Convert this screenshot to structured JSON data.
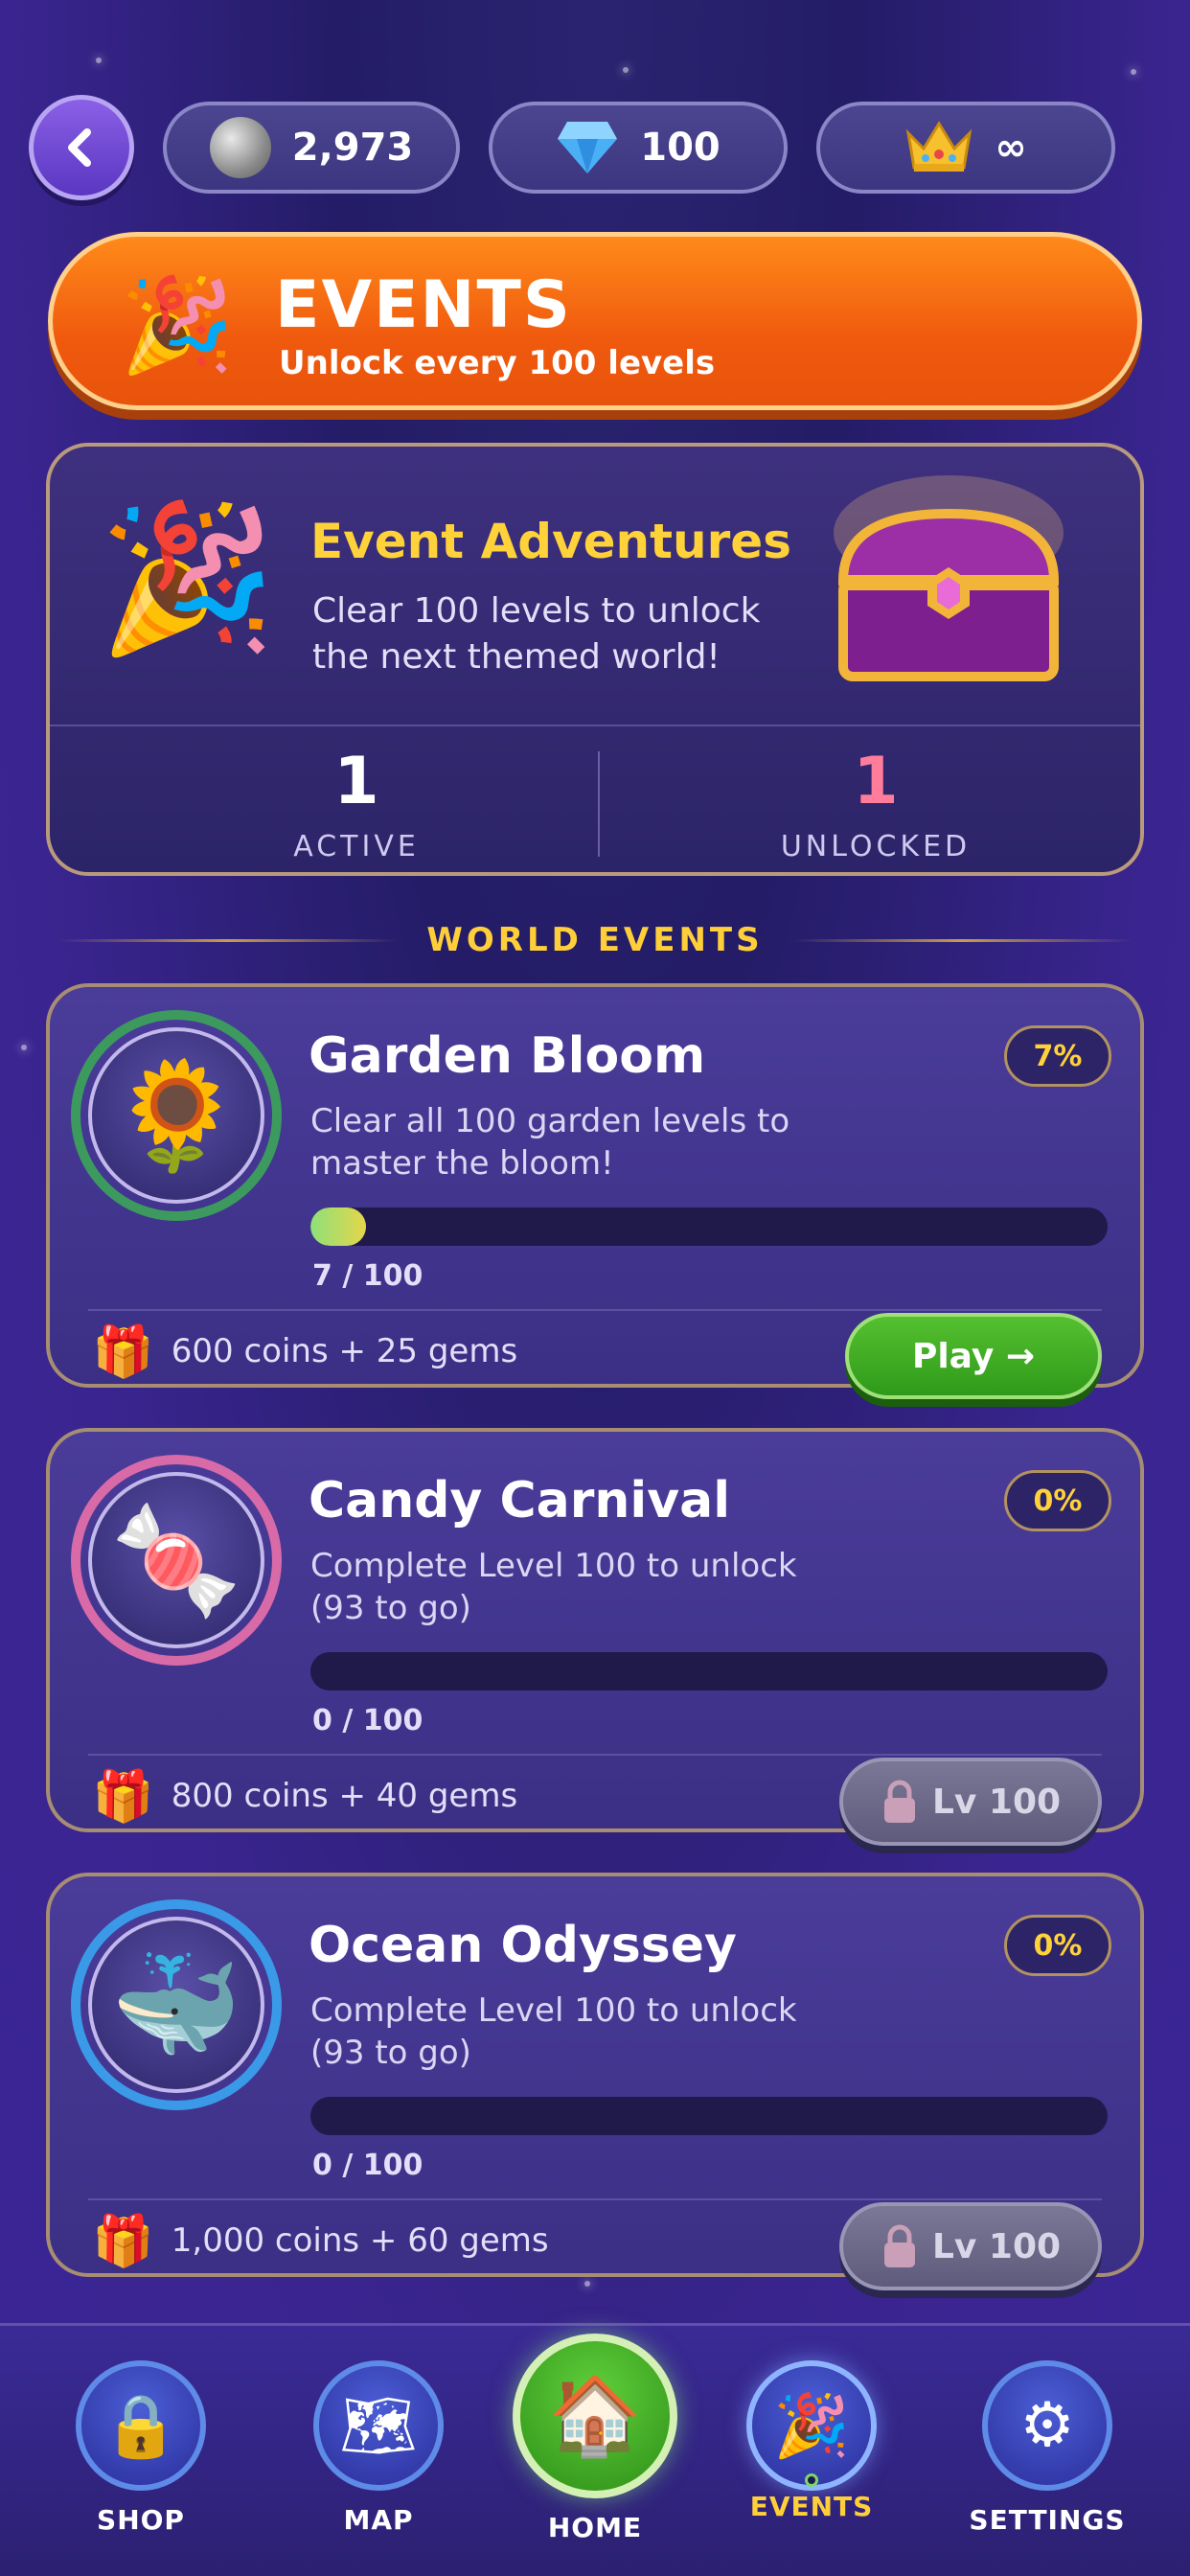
{
  "header": {
    "coins": "2,973",
    "gems": "100",
    "crowns": "∞",
    "icons": {
      "back": "back-arrow-icon",
      "coin": "coin-icon",
      "gem": "diamond-icon",
      "crown": "crown-icon"
    }
  },
  "banner": {
    "title": "EVENTS",
    "subtitle": "Unlock every 100 levels",
    "icon": "🎉"
  },
  "adventures": {
    "title": "Event Adventures",
    "description": "Clear 100 levels to unlock the next themed world!",
    "icon": "🎉",
    "stats": [
      {
        "value": "1",
        "label": "ACTIVE"
      },
      {
        "value": "1",
        "label": "UNLOCKED"
      }
    ]
  },
  "world_events_heading": "WORLD EVENTS",
  "events": [
    {
      "name": "Garden Bloom",
      "description": "Clear all 100 garden levels to master the bloom!",
      "percent": "7%",
      "progress_text": "7 / 100",
      "progress_fraction": 0.07,
      "reward": "600 coins + 25 gems",
      "icon": "🌻",
      "ring_color": "#3c9a5e",
      "action": "Play →",
      "locked": false
    },
    {
      "name": "Candy Carnival",
      "description": "Complete Level 100 to unlock (93 to go)",
      "percent": "0%",
      "progress_text": "0 / 100",
      "progress_fraction": 0,
      "reward": "800 coins + 40 gems",
      "icon": "🍬",
      "ring_color": "#d86aa8",
      "action": "Lv 100",
      "locked": true
    },
    {
      "name": "Ocean Odyssey",
      "description": "Complete Level 100 to unlock (93 to go)",
      "percent": "0%",
      "progress_text": "0 / 100",
      "progress_fraction": 0,
      "reward": "1,000 coins + 60 gems",
      "icon": "🐳",
      "ring_color": "#3a9ae8",
      "action": "Lv 100",
      "locked": true
    }
  ],
  "nav": [
    {
      "label": "SHOP",
      "icon": "🔒"
    },
    {
      "label": "MAP",
      "icon": "🗺"
    },
    {
      "label": "HOME",
      "icon": "🏠"
    },
    {
      "label": "EVENTS",
      "icon": "🎉"
    },
    {
      "label": "SETTINGS",
      "icon": "⚙"
    }
  ]
}
